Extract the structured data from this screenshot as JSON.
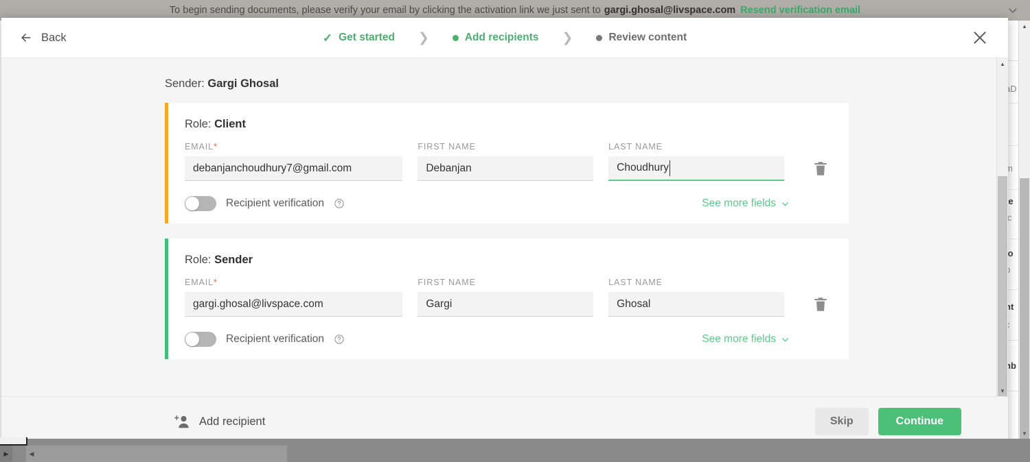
{
  "background": {
    "banner": {
      "text_before": "To begin sending documents, please verify your email by clicking the activation link we just sent to",
      "email": "gargi.ghosal@livspace.com",
      "link": "Resend verification email",
      "collapse_icon": "chevron-down-icon",
      "link_color": "#3aa96a"
    },
    "right_fragments": [
      {
        "text": "aD",
        "bold": false
      },
      {
        "text": "m",
        "bold": false
      },
      {
        "text": "te",
        "bold": true
      },
      {
        "text": "lc",
        "bold": false
      },
      {
        "text": "io",
        "bold": true
      },
      {
        "text": "b",
        "bold": false
      },
      {
        "text": "nt",
        "bold": true
      },
      {
        "text": "c",
        "bold": false
      },
      {
        "text": "nb",
        "bold": true
      }
    ]
  },
  "modal": {
    "header": {
      "back_label": "Back",
      "back_icon": "arrow-left-icon",
      "close_icon": "close-icon",
      "steps": [
        {
          "label": "Get started",
          "state": "done",
          "marker": "check-icon"
        },
        {
          "label": "Add recipients",
          "state": "current",
          "marker": "dot"
        },
        {
          "label": "Review content",
          "state": "todo",
          "marker": "dot"
        }
      ],
      "separator": "❯"
    },
    "sender": {
      "prefix": "Sender:",
      "name": "Gargi Ghosal"
    },
    "recipients": [
      {
        "role_prefix": "Role:",
        "role": "Client",
        "accent_color": "#f5a623",
        "fields": {
          "email": {
            "label": "EMAIL",
            "required": true,
            "value": "debanjanchoudhury7@gmail.com",
            "focused": false
          },
          "first_name": {
            "label": "FIRST NAME",
            "required": false,
            "value": "Debanjan",
            "focused": false
          },
          "last_name": {
            "label": "LAST NAME",
            "required": false,
            "value": "Choudhury",
            "focused": true
          }
        },
        "delete_icon": "trash-icon",
        "verification": {
          "label": "Recipient verification",
          "enabled": false,
          "help_icon": "help-circle-icon"
        },
        "see_more": {
          "label": "See more fields",
          "icon": "chevron-down-icon"
        }
      },
      {
        "role_prefix": "Role:",
        "role": "Sender",
        "accent_color": "#3fbf79",
        "fields": {
          "email": {
            "label": "EMAIL",
            "required": true,
            "value": "gargi.ghosal@livspace.com",
            "focused": false
          },
          "first_name": {
            "label": "FIRST NAME",
            "required": false,
            "value": "Gargi",
            "focused": false
          },
          "last_name": {
            "label": "LAST NAME",
            "required": false,
            "value": "Ghosal",
            "focused": false
          }
        },
        "delete_icon": "trash-icon",
        "verification": {
          "label": "Recipient verification",
          "enabled": false,
          "help_icon": "help-circle-icon"
        },
        "see_more": {
          "label": "See more fields",
          "icon": "chevron-down-icon"
        }
      }
    ],
    "footer": {
      "add_recipient_label": "Add recipient",
      "add_recipient_icon": "add-person-icon",
      "skip_label": "Skip",
      "continue_label": "Continue",
      "continue_color": "#4cbf79"
    }
  }
}
